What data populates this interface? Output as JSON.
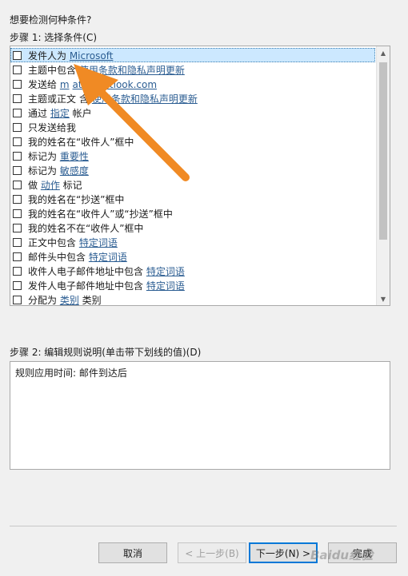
{
  "header": {
    "question": "想要检测何种条件?",
    "step1_label": "步骤 1: 选择条件(C)"
  },
  "conditions": [
    {
      "segments": [
        {
          "t": "发件人为 "
        },
        {
          "t": "Microsoft",
          "link": true
        }
      ],
      "selected": true
    },
    {
      "segments": [
        {
          "t": "主题中包含 "
        },
        {
          "t": "使用条款和隐私声明更新",
          "link": true
        }
      ]
    },
    {
      "segments": [
        {
          "t": "发送给 "
        },
        {
          "t": "m",
          "link": true
        },
        {
          "t": "GAP"
        },
        {
          "t": "ate@outlook.com",
          "link": true
        }
      ]
    },
    {
      "segments": [
        {
          "t": "主题或正文"
        },
        {
          "t": "GAP"
        },
        {
          "t": "含 "
        },
        {
          "t": "使用条款和隐私声明更新",
          "link": true
        }
      ]
    },
    {
      "segments": [
        {
          "t": "通过 "
        },
        {
          "t": "指定",
          "link": true
        },
        {
          "t": " 帐户"
        }
      ]
    },
    {
      "segments": [
        {
          "t": "只发送给我"
        }
      ]
    },
    {
      "segments": [
        {
          "t": "我的姓名在“收件人”框中"
        }
      ]
    },
    {
      "segments": [
        {
          "t": "标记为 "
        },
        {
          "t": "重要性",
          "link": true
        }
      ]
    },
    {
      "segments": [
        {
          "t": "标记为 "
        },
        {
          "t": "敏感度",
          "link": true
        }
      ]
    },
    {
      "segments": [
        {
          "t": "做 "
        },
        {
          "t": "动作",
          "link": true
        },
        {
          "t": " 标记"
        }
      ]
    },
    {
      "segments": [
        {
          "t": "我的姓名在“抄送”框中"
        }
      ]
    },
    {
      "segments": [
        {
          "t": "我的姓名在“收件人”或“抄送”框中"
        }
      ]
    },
    {
      "segments": [
        {
          "t": "我的姓名不在“收件人”框中"
        }
      ]
    },
    {
      "segments": [
        {
          "t": "正文中包含 "
        },
        {
          "t": "特定词语",
          "link": true
        }
      ]
    },
    {
      "segments": [
        {
          "t": "邮件头中包含 "
        },
        {
          "t": "特定词语",
          "link": true
        }
      ]
    },
    {
      "segments": [
        {
          "t": "收件人电子邮件地址中包含 "
        },
        {
          "t": "特定词语",
          "link": true
        }
      ]
    },
    {
      "segments": [
        {
          "t": "发件人电子邮件地址中包含 "
        },
        {
          "t": "特定词语",
          "link": true
        }
      ]
    },
    {
      "segments": [
        {
          "t": "分配为 "
        },
        {
          "t": "类别",
          "link": true
        },
        {
          "t": " 类别"
        }
      ]
    }
  ],
  "scroll": {
    "up_glyph": "▲",
    "down_glyph": "▼"
  },
  "step2": {
    "label": "步骤 2: 编辑规则说明(单击带下划线的值)(D)",
    "description": "规则应用时间: 邮件到达后"
  },
  "buttons": {
    "cancel": "取消",
    "back": "< 上一步(B)",
    "next": "下一步(N) >",
    "finish": "完成"
  },
  "watermark": "Baidu经验",
  "colors": {
    "link": "#2b5d92",
    "selection": "#cce8ff",
    "arrow": "#f08a24"
  }
}
